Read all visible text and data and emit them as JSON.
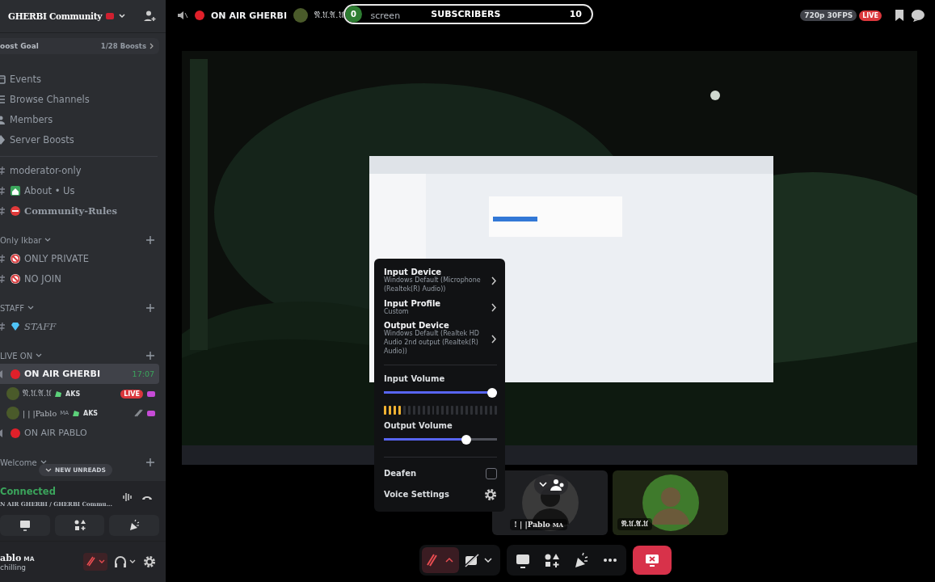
{
  "sidebar": {
    "server": {
      "name": "GHERBI Community",
      "boost_label": "oost Goal",
      "boost_count": "1/28 Boosts"
    },
    "nav": [
      {
        "label": "Events"
      },
      {
        "label": "Browse Channels"
      },
      {
        "label": "Members"
      },
      {
        "label": "Server Boosts"
      }
    ],
    "channels": [
      {
        "kind": "text",
        "name": "moderator-only"
      },
      {
        "kind": "text",
        "name": "About • Us"
      },
      {
        "kind": "text",
        "name": "Community-Rules"
      },
      {
        "kind": "category",
        "name": "Only Ikbar"
      },
      {
        "kind": "text",
        "name": "ONLY PRIVATE"
      },
      {
        "kind": "text",
        "name": "NO JOIN"
      },
      {
        "kind": "category",
        "name": "STAFF"
      },
      {
        "kind": "text",
        "name": "STAFF"
      },
      {
        "kind": "category",
        "name": "LIVE ON"
      },
      {
        "kind": "voice",
        "name": "ON AIR GHERBI",
        "selected": true,
        "time": "17:07"
      },
      {
        "kind": "user",
        "name": "𝔑.𝔘.𝔄.𝔘",
        "clan": "AKS",
        "badge": "LIVE",
        "muted": false
      },
      {
        "kind": "user",
        "name": "| | |Pablo",
        "tag": "MA",
        "clan": "AKS",
        "muted": true
      },
      {
        "kind": "voice",
        "name": "ON AIR PABLO",
        "selected": false
      },
      {
        "kind": "category",
        "name": "Welcome"
      }
    ],
    "unreads": "NEW UNREADS",
    "connection": {
      "status": "Connected",
      "channel": "N AIR GHERBI / GHERBI Commu..."
    },
    "user": {
      "name": "ablo",
      "tag": "MA",
      "status": "chilling",
      "mic_muted": true
    }
  },
  "topbar": {
    "channel": "ON AIR GHERBI",
    "streamer": "𝔑.𝔘.𝔄.𝔘",
    "label": "screen",
    "quality": "720p 30FPS",
    "live": "LIVE"
  },
  "subscribers": {
    "current": "0",
    "title": "SUBSCRIBERS",
    "goal": "10",
    "level": 0.0
  },
  "voice_menu": {
    "items": [
      {
        "title": "Input Device",
        "value": "Windows Default (Microphone (Realtek(R) Audio))"
      },
      {
        "title": "Input Profile",
        "value": "Custom"
      },
      {
        "title": "Output Device",
        "value": "Windows Default (Realtek HD Audio 2nd output (Realtek(R) Audio))"
      }
    ],
    "input_volume": {
      "label": "Input Volume",
      "level": 1.0
    },
    "input_meter": {
      "level": 0.17
    },
    "output_volume": {
      "label": "Output Volume",
      "level": 0.75
    },
    "deafen": {
      "label": "Deafen",
      "checked": false
    },
    "settings": {
      "label": "Voice Settings"
    }
  },
  "tiles": [
    {
      "name": "! | |Pablo",
      "tag": "MA"
    },
    {
      "name": "𝔑.𝔘.𝔄.𝔘"
    }
  ],
  "controls": {
    "mic_muted": true,
    "camera_on": false
  }
}
